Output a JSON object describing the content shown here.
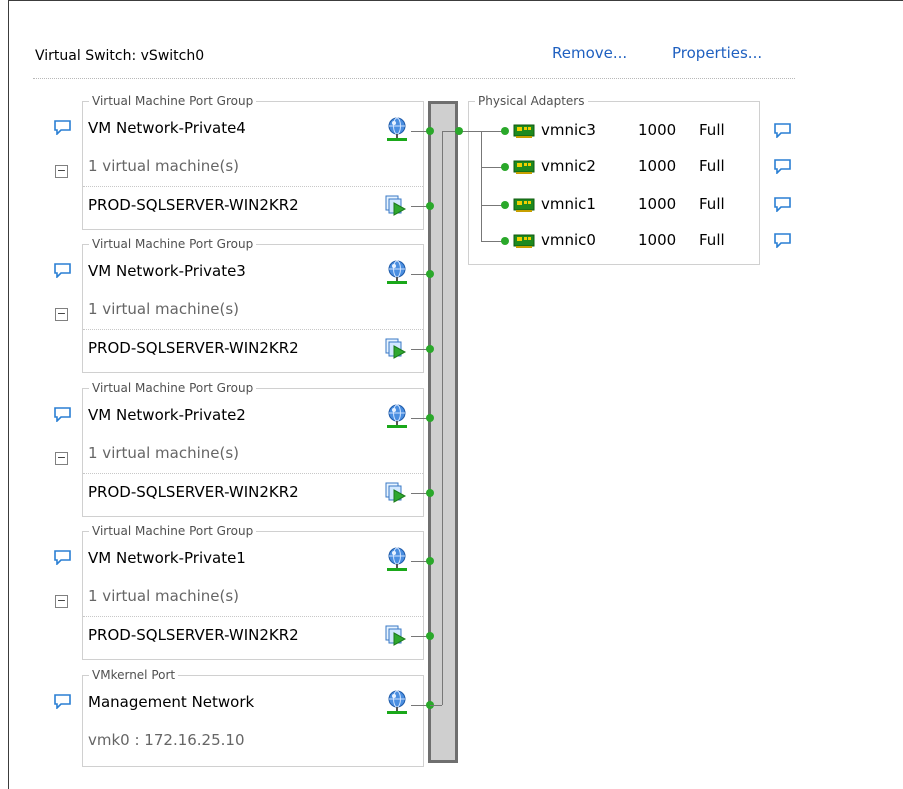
{
  "header": {
    "title": "Virtual Switch: vSwitch0",
    "remove_label": "Remove...",
    "properties_label": "Properties..."
  },
  "port_groups": [
    {
      "type_label": "Virtual Machine Port Group",
      "name": "VM Network-Private4",
      "vm_count_label": "1 virtual machine(s)",
      "vm_name": "PROD-SQLSERVER-WIN2KR2",
      "expander": "−"
    },
    {
      "type_label": "Virtual Machine Port Group",
      "name": "VM Network-Private3",
      "vm_count_label": "1 virtual machine(s)",
      "vm_name": "PROD-SQLSERVER-WIN2KR2",
      "expander": "−"
    },
    {
      "type_label": "Virtual Machine Port Group",
      "name": "VM Network-Private2",
      "vm_count_label": "1 virtual machine(s)",
      "vm_name": "PROD-SQLSERVER-WIN2KR2",
      "expander": "−"
    },
    {
      "type_label": "Virtual Machine Port Group",
      "name": "VM Network-Private1",
      "vm_count_label": "1 virtual machine(s)",
      "vm_name": "PROD-SQLSERVER-WIN2KR2",
      "expander": "−"
    }
  ],
  "vmkernel": {
    "type_label": "VMkernel Port",
    "name": "Management Network",
    "address": "vmk0 : 172.16.25.10"
  },
  "physical_adapters": {
    "label": "Physical Adapters",
    "items": [
      {
        "name": "vmnic3",
        "speed": "1000",
        "duplex": "Full"
      },
      {
        "name": "vmnic2",
        "speed": "1000",
        "duplex": "Full"
      },
      {
        "name": "vmnic1",
        "speed": "1000",
        "duplex": "Full"
      },
      {
        "name": "vmnic0",
        "speed": "1000",
        "duplex": "Full"
      }
    ]
  },
  "icons": {
    "info": "speech-bubble-icon",
    "port_group": "network-globe-icon",
    "vm": "virtual-machine-icon",
    "nic": "network-card-icon"
  },
  "colors": {
    "link": "#1f60c0",
    "connector": "#2aa82a",
    "bus_fill": "#cfcfcf",
    "bus_border": "#6f6f6f"
  }
}
